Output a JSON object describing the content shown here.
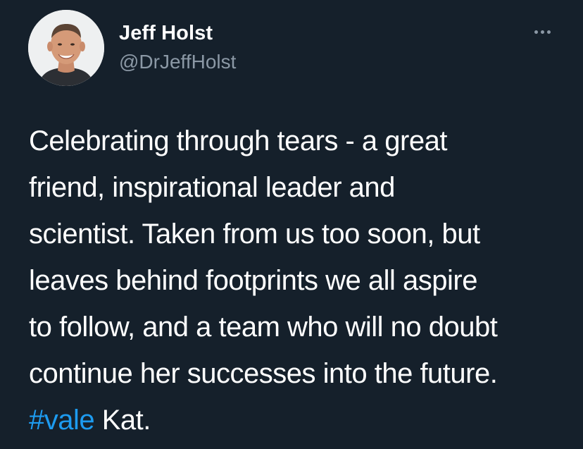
{
  "author": {
    "name": "Jeff Holst",
    "handle": "@DrJeffHolst",
    "avatar_icon": "profile-photo"
  },
  "menu": {
    "more_icon": "ellipsis-icon"
  },
  "tweet": {
    "lines": [
      "Celebrating through tears - a great",
      "friend, inspirational leader and",
      "scientist. Taken from us too soon, but",
      "leaves behind footprints we all aspire",
      "to follow, and a team who will no doubt",
      "continue her successes into the future."
    ],
    "hashtag": "#vale",
    "last_text": " Kat."
  },
  "colors": {
    "background": "#15202b",
    "text": "#ffffff",
    "secondary_text": "#8b98a5",
    "link": "#1d9bf0"
  }
}
